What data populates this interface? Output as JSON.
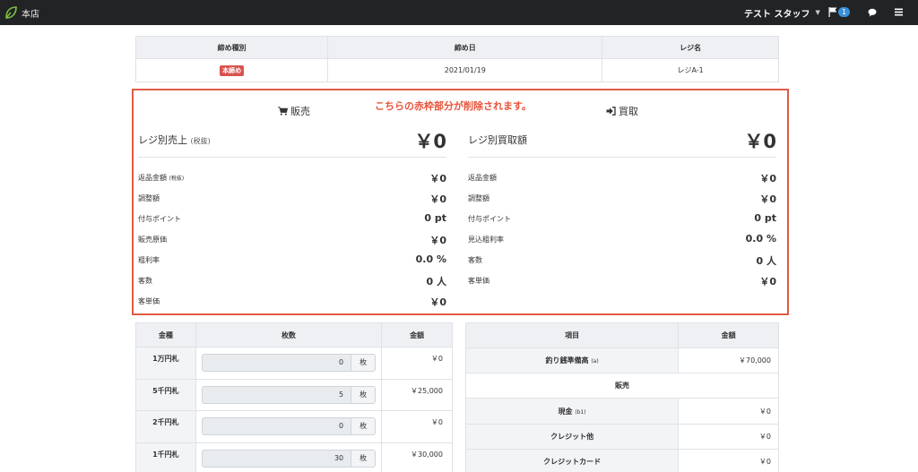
{
  "topbar": {
    "store_name": "本店",
    "user_name": "テスト スタッフ",
    "notification_count": "1"
  },
  "closing": {
    "headers": [
      "締め種別",
      "締め日",
      "レジ名"
    ],
    "type_badge": "本締め",
    "date": "2021/01/19",
    "register": "レジA-1"
  },
  "notice": "こちらの赤枠部分が削除されます。",
  "sales": {
    "title": "販売",
    "main_label": "レジ別売上",
    "main_label_note": "(税抜)",
    "main_value": "￥0",
    "rows": [
      {
        "label": "返品金額",
        "note": "(税抜)",
        "value": "￥0"
      },
      {
        "label": "調整額",
        "note": "",
        "value": "￥0"
      },
      {
        "label": "付与ポイント",
        "note": "",
        "value": "0 pt"
      },
      {
        "label": "販売原価",
        "note": "",
        "value": "￥0"
      },
      {
        "label": "粗利率",
        "note": "",
        "value": "0.0 %"
      },
      {
        "label": "客数",
        "note": "",
        "value": "0 人"
      },
      {
        "label": "客単価",
        "note": "",
        "value": "￥0"
      }
    ]
  },
  "purchase": {
    "title": "買取",
    "main_label": "レジ別買取額",
    "main_value": "￥0",
    "rows": [
      {
        "label": "返品金額",
        "value": "￥0"
      },
      {
        "label": "調整額",
        "value": "￥0"
      },
      {
        "label": "付与ポイント",
        "value": "0 pt"
      },
      {
        "label": "見込粗利率",
        "value": "0.0 %"
      },
      {
        "label": "客数",
        "value": "0 人"
      },
      {
        "label": "客単価",
        "value": "￥0"
      }
    ]
  },
  "denominations": {
    "headers": [
      "金種",
      "枚数",
      "金額"
    ],
    "unit": "枚",
    "rows": [
      {
        "kind": "1万円札",
        "count": "0",
        "amount": "￥0"
      },
      {
        "kind": "5千円札",
        "count": "5",
        "amount": "￥25,000"
      },
      {
        "kind": "2千円札",
        "count": "0",
        "amount": "￥0"
      },
      {
        "kind": "1千円札",
        "count": "30",
        "amount": "￥30,000"
      }
    ]
  },
  "items": {
    "headers": [
      "項目",
      "金額"
    ],
    "float_label": "釣り銭準備高",
    "float_note": "(a)",
    "float_value": "￥70,000",
    "section_sales": "販売",
    "rows": [
      {
        "label": "現金",
        "note": "(b1)",
        "value": "￥0"
      },
      {
        "label": "クレジット他",
        "note": "",
        "value": "￥0"
      },
      {
        "label": "クレジットカード",
        "note": "",
        "value": "￥0"
      }
    ]
  },
  "colors": {
    "topbar": "#222325",
    "highlight_border": "#e05a45",
    "notice_text": "#e8533a",
    "badge_red": "#d9534f",
    "badge_blue": "#3a8fd8"
  }
}
